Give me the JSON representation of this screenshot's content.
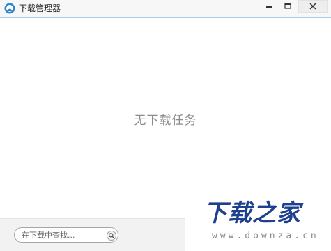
{
  "window": {
    "title": "下载管理器"
  },
  "main": {
    "empty_message": "无下载任务"
  },
  "search": {
    "placeholder": "在下载中查找..."
  },
  "watermark": {
    "logo_text": "下载之家",
    "url": "www.downza.cn"
  },
  "colors": {
    "title_bar": "#f7f7f7",
    "title_border": "#a9cde8",
    "empty_text": "#8c8c8c",
    "watermark_blue": "#1f3f8f"
  },
  "icons": {
    "app": "download-manager-icon",
    "minimize": "minimize-icon",
    "maximize": "maximize-icon",
    "close": "close-icon",
    "search": "search-icon"
  }
}
